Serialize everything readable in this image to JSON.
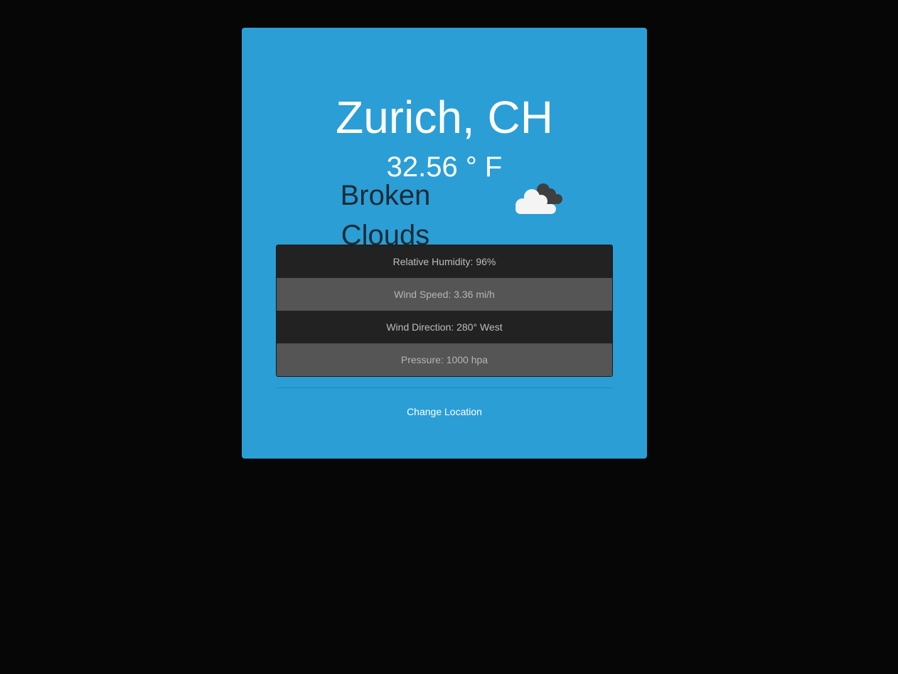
{
  "weather": {
    "location": "Zurich, CH",
    "temperature": "32.56 ° F",
    "condition": "Broken Clouds",
    "icon": "broken-clouds-icon"
  },
  "details": [
    {
      "text": "Relative Humidity: 96%"
    },
    {
      "text": "Wind Speed: 3.36 mi/h"
    },
    {
      "text": "Wind Direction: 280° West"
    },
    {
      "text": "Pressure: 1000 hpa"
    }
  ],
  "actions": {
    "change_location": "Change Location"
  },
  "colors": {
    "background": "#060606",
    "card": "#2b9ed6",
    "row_dark": "#222222",
    "row_light": "#555555"
  }
}
